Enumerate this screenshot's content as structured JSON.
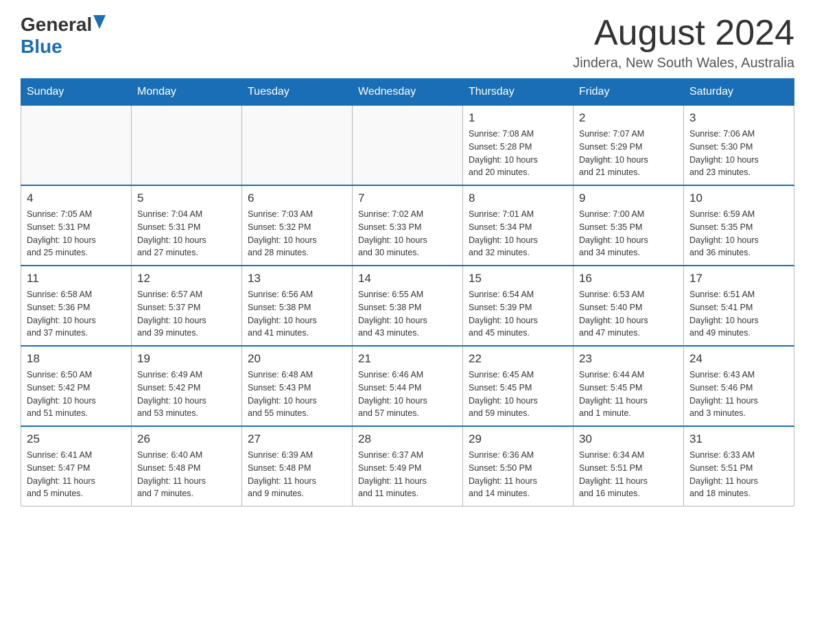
{
  "header": {
    "logo_general": "General",
    "logo_blue": "Blue",
    "month_title": "August 2024",
    "location": "Jindera, New South Wales, Australia"
  },
  "days_of_week": [
    "Sunday",
    "Monday",
    "Tuesday",
    "Wednesday",
    "Thursday",
    "Friday",
    "Saturday"
  ],
  "weeks": [
    {
      "days": [
        {
          "num": "",
          "info": ""
        },
        {
          "num": "",
          "info": ""
        },
        {
          "num": "",
          "info": ""
        },
        {
          "num": "",
          "info": ""
        },
        {
          "num": "1",
          "info": "Sunrise: 7:08 AM\nSunset: 5:28 PM\nDaylight: 10 hours\nand 20 minutes."
        },
        {
          "num": "2",
          "info": "Sunrise: 7:07 AM\nSunset: 5:29 PM\nDaylight: 10 hours\nand 21 minutes."
        },
        {
          "num": "3",
          "info": "Sunrise: 7:06 AM\nSunset: 5:30 PM\nDaylight: 10 hours\nand 23 minutes."
        }
      ]
    },
    {
      "days": [
        {
          "num": "4",
          "info": "Sunrise: 7:05 AM\nSunset: 5:31 PM\nDaylight: 10 hours\nand 25 minutes."
        },
        {
          "num": "5",
          "info": "Sunrise: 7:04 AM\nSunset: 5:31 PM\nDaylight: 10 hours\nand 27 minutes."
        },
        {
          "num": "6",
          "info": "Sunrise: 7:03 AM\nSunset: 5:32 PM\nDaylight: 10 hours\nand 28 minutes."
        },
        {
          "num": "7",
          "info": "Sunrise: 7:02 AM\nSunset: 5:33 PM\nDaylight: 10 hours\nand 30 minutes."
        },
        {
          "num": "8",
          "info": "Sunrise: 7:01 AM\nSunset: 5:34 PM\nDaylight: 10 hours\nand 32 minutes."
        },
        {
          "num": "9",
          "info": "Sunrise: 7:00 AM\nSunset: 5:35 PM\nDaylight: 10 hours\nand 34 minutes."
        },
        {
          "num": "10",
          "info": "Sunrise: 6:59 AM\nSunset: 5:35 PM\nDaylight: 10 hours\nand 36 minutes."
        }
      ]
    },
    {
      "days": [
        {
          "num": "11",
          "info": "Sunrise: 6:58 AM\nSunset: 5:36 PM\nDaylight: 10 hours\nand 37 minutes."
        },
        {
          "num": "12",
          "info": "Sunrise: 6:57 AM\nSunset: 5:37 PM\nDaylight: 10 hours\nand 39 minutes."
        },
        {
          "num": "13",
          "info": "Sunrise: 6:56 AM\nSunset: 5:38 PM\nDaylight: 10 hours\nand 41 minutes."
        },
        {
          "num": "14",
          "info": "Sunrise: 6:55 AM\nSunset: 5:38 PM\nDaylight: 10 hours\nand 43 minutes."
        },
        {
          "num": "15",
          "info": "Sunrise: 6:54 AM\nSunset: 5:39 PM\nDaylight: 10 hours\nand 45 minutes."
        },
        {
          "num": "16",
          "info": "Sunrise: 6:53 AM\nSunset: 5:40 PM\nDaylight: 10 hours\nand 47 minutes."
        },
        {
          "num": "17",
          "info": "Sunrise: 6:51 AM\nSunset: 5:41 PM\nDaylight: 10 hours\nand 49 minutes."
        }
      ]
    },
    {
      "days": [
        {
          "num": "18",
          "info": "Sunrise: 6:50 AM\nSunset: 5:42 PM\nDaylight: 10 hours\nand 51 minutes."
        },
        {
          "num": "19",
          "info": "Sunrise: 6:49 AM\nSunset: 5:42 PM\nDaylight: 10 hours\nand 53 minutes."
        },
        {
          "num": "20",
          "info": "Sunrise: 6:48 AM\nSunset: 5:43 PM\nDaylight: 10 hours\nand 55 minutes."
        },
        {
          "num": "21",
          "info": "Sunrise: 6:46 AM\nSunset: 5:44 PM\nDaylight: 10 hours\nand 57 minutes."
        },
        {
          "num": "22",
          "info": "Sunrise: 6:45 AM\nSunset: 5:45 PM\nDaylight: 10 hours\nand 59 minutes."
        },
        {
          "num": "23",
          "info": "Sunrise: 6:44 AM\nSunset: 5:45 PM\nDaylight: 11 hours\nand 1 minute."
        },
        {
          "num": "24",
          "info": "Sunrise: 6:43 AM\nSunset: 5:46 PM\nDaylight: 11 hours\nand 3 minutes."
        }
      ]
    },
    {
      "days": [
        {
          "num": "25",
          "info": "Sunrise: 6:41 AM\nSunset: 5:47 PM\nDaylight: 11 hours\nand 5 minutes."
        },
        {
          "num": "26",
          "info": "Sunrise: 6:40 AM\nSunset: 5:48 PM\nDaylight: 11 hours\nand 7 minutes."
        },
        {
          "num": "27",
          "info": "Sunrise: 6:39 AM\nSunset: 5:48 PM\nDaylight: 11 hours\nand 9 minutes."
        },
        {
          "num": "28",
          "info": "Sunrise: 6:37 AM\nSunset: 5:49 PM\nDaylight: 11 hours\nand 11 minutes."
        },
        {
          "num": "29",
          "info": "Sunrise: 6:36 AM\nSunset: 5:50 PM\nDaylight: 11 hours\nand 14 minutes."
        },
        {
          "num": "30",
          "info": "Sunrise: 6:34 AM\nSunset: 5:51 PM\nDaylight: 11 hours\nand 16 minutes."
        },
        {
          "num": "31",
          "info": "Sunrise: 6:33 AM\nSunset: 5:51 PM\nDaylight: 11 hours\nand 18 minutes."
        }
      ]
    }
  ]
}
